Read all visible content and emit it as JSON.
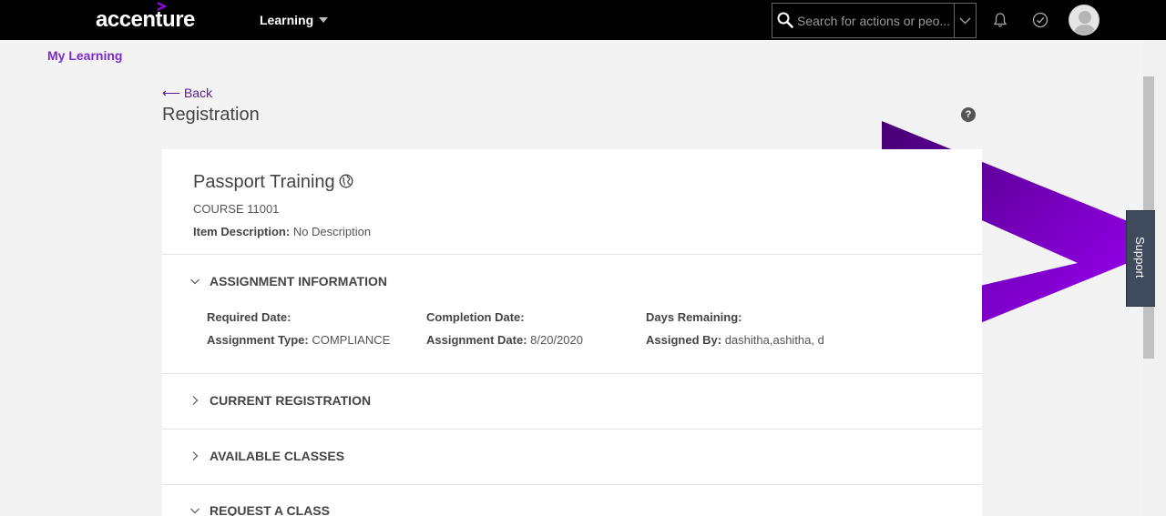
{
  "header": {
    "logo_text": "accenture",
    "nav_label": "Learning",
    "search_placeholder": "Search for actions or peo..."
  },
  "breadcrumb": {
    "my_learning": "My Learning"
  },
  "page": {
    "back_label": "Back",
    "back_arrow": "⟵",
    "title": "Registration",
    "help_symbol": "?"
  },
  "course": {
    "title": "Passport Training",
    "code": "COURSE 11001",
    "desc_label": "Item Description:",
    "desc_value": "No Description"
  },
  "assignment": {
    "header": "ASSIGNMENT INFORMATION",
    "required_date_label": "Required Date:",
    "required_date_value": "",
    "completion_date_label": "Completion Date:",
    "completion_date_value": "",
    "days_remaining_label": "Days Remaining:",
    "days_remaining_value": "",
    "assignment_type_label": "Assignment Type:",
    "assignment_type_value": "COMPLIANCE",
    "assignment_date_label": "Assignment Date:",
    "assignment_date_value": "8/20/2020",
    "assigned_by_label": "Assigned By:",
    "assigned_by_value": "dashitha,ashitha, d"
  },
  "sections": {
    "current_registration": "CURRENT REGISTRATION",
    "available_classes": "AVAILABLE CLASSES",
    "request_class": "REQUEST A CLASS"
  },
  "support_label": "Support",
  "colors": {
    "brand_purple": "#a100ff",
    "link_purple": "#7b2bd0",
    "topbar": "#000000"
  },
  "icons": [
    "search-icon",
    "chevron-down-icon",
    "bell-icon",
    "check-circle-icon",
    "avatar",
    "help-icon",
    "globe-icon"
  ]
}
